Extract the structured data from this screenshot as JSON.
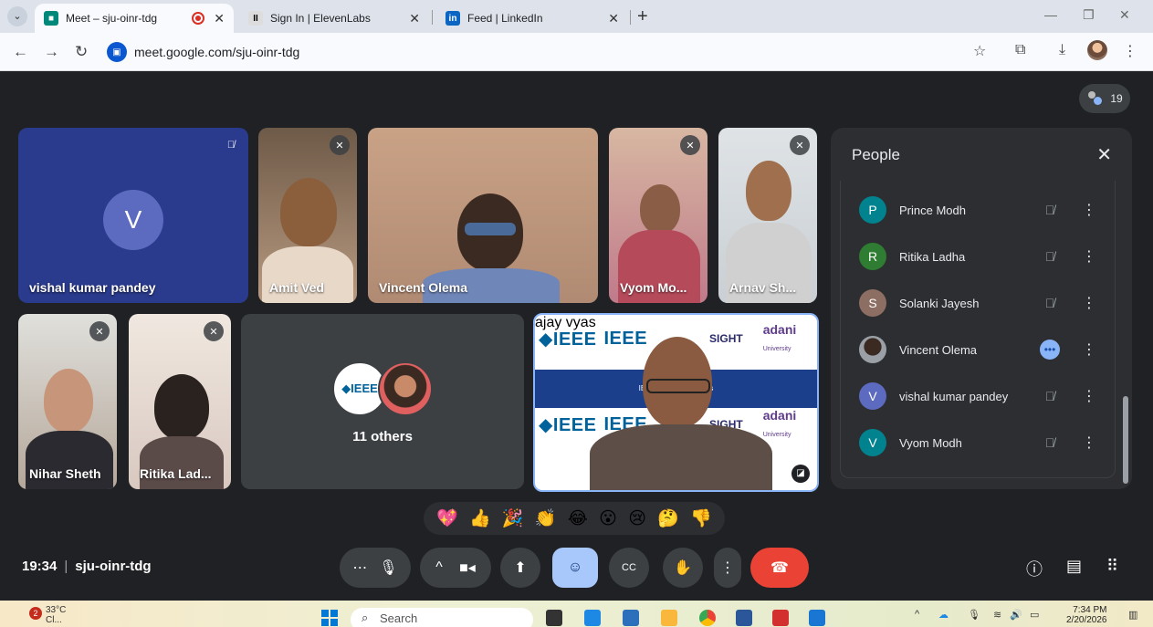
{
  "browser": {
    "tabs": [
      {
        "title": "Meet – sju-oinr-tdg",
        "active": true,
        "recording": true
      },
      {
        "title": "Sign In | ElevenLabs",
        "active": false
      },
      {
        "title": "Feed | LinkedIn",
        "active": false
      }
    ],
    "url": "meet.google.com/sju-oinr-tdg"
  },
  "meet": {
    "participant_count": "19",
    "tiles": {
      "vishal": {
        "name": "vishal kumar pandey",
        "initial": "V"
      },
      "amit": {
        "name": "Amit Ved"
      },
      "vincent": {
        "name": "Vincent Olema"
      },
      "vyom": {
        "name": "Vyom Mo..."
      },
      "arnav": {
        "name": "Arnav Sh..."
      },
      "nihar": {
        "name": "Nihar Sheth"
      },
      "ritika": {
        "name": "Ritika Lad..."
      },
      "others": {
        "label": "11 others",
        "logo_text": "◆IEEE"
      },
      "ajay": {
        "name": "ajay vyas"
      }
    },
    "presentation": {
      "logo1": "◆IEEE",
      "logo2": "IEEE",
      "logo3": "SIGHT",
      "logo4": "adani",
      "logo4_sub": "University",
      "band_text": "IEEE | Hum...                                Activities"
    },
    "people_panel": {
      "title": "People",
      "people": [
        {
          "initial": "P",
          "name": "Prince Modh",
          "color": "#00838f",
          "status": "muted"
        },
        {
          "initial": "R",
          "name": "Ritika Ladha",
          "color": "#2e7d32",
          "status": "muted"
        },
        {
          "initial": "S",
          "name": "Solanki Jayesh",
          "color": "#8d6e63",
          "status": "muted"
        },
        {
          "initial": "",
          "name": "Vincent Olema",
          "color": "#5d4037",
          "status": "more"
        },
        {
          "initial": "V",
          "name": "vishal kumar pandey",
          "color": "#5c6bc0",
          "status": "muted"
        },
        {
          "initial": "V",
          "name": "Vyom Modh",
          "color": "#00838f",
          "status": "muted"
        }
      ]
    },
    "reactions": [
      "💖",
      "👍",
      "🎉",
      "👏",
      "😂",
      "😮",
      "😢",
      "🤔",
      "👎"
    ],
    "meeting_time": "19:34",
    "meeting_code": "sju-oinr-tdg"
  },
  "taskbar": {
    "temperature": "33°C",
    "weather_sub": "Cl...",
    "notif_count": "2",
    "search_placeholder": "Search",
    "time": "7:34 PM",
    "date": "2/20/2026"
  }
}
